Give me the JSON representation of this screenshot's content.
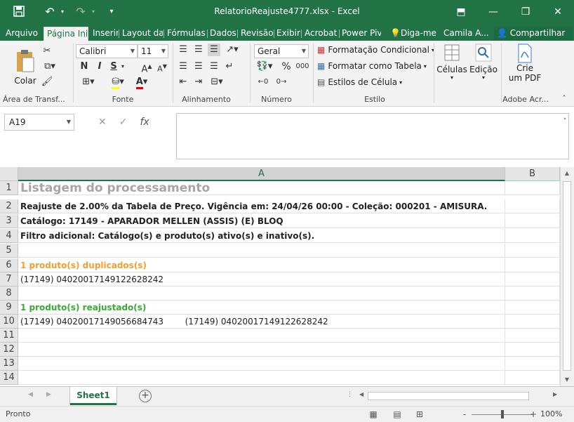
{
  "window": {
    "title": "RelatorioReajuste4777.xlsx - Excel",
    "minimize": "—",
    "restore": "❐",
    "close": "✕",
    "ribbon_display": "⬒"
  },
  "tabs": [
    {
      "label": "Arquivo"
    },
    {
      "label": "Página Inicial"
    },
    {
      "label": "Inserir"
    },
    {
      "label": "Layout da Página"
    },
    {
      "label": "Fórmulas"
    },
    {
      "label": "Dados"
    },
    {
      "label": "Revisão"
    },
    {
      "label": "Exibir"
    },
    {
      "label": "Acrobat"
    },
    {
      "label": "Power Pivot"
    },
    {
      "label": "Diga-me"
    },
    {
      "label": "Camila A..."
    },
    {
      "label": "Compartilhar"
    }
  ],
  "ribbon": {
    "paste_label": "Colar",
    "clipboard_label": "Área de Transf...",
    "font_name": "Calibri",
    "font_size": "11",
    "bold": "N",
    "italic": "I",
    "underline": "S",
    "font_label": "Fonte",
    "align_label": "Alinhamento",
    "number_format": "Geral",
    "percent": "%",
    "thousands": "000",
    "number_label": "Número",
    "cond_format": "Formatação Condicional",
    "format_table": "Formatar como Tabela",
    "cell_styles": "Estilos de Célula",
    "styles_label": "Estilo",
    "cells_label": "Células",
    "edit_label": "Edição",
    "create_pdf_line1": "Crie",
    "create_pdf_line2": "um PDF",
    "adobe_label": "Adobe Acr..."
  },
  "formula_bar": {
    "name_box": "A19",
    "cancel": "✕",
    "enter": "✓",
    "fx": "fx",
    "value": ""
  },
  "grid": {
    "columns": [
      "A",
      "B"
    ],
    "rows": [
      {
        "num": "1",
        "text": "Listagem do processamento",
        "style": "title"
      },
      {
        "num": "2",
        "text": "Reajuste de 2.00% da Tabela de Preço. Vigência em: 24/04/26 00:00 - Coleção: 000201 - AMISURA.",
        "style": "bold"
      },
      {
        "num": "3",
        "text": "Catálogo: 17149 - APARADOR MELLEN (ASSIS) (E) BLOQ",
        "style": "bold"
      },
      {
        "num": "4",
        "text": "Filtro adicional: Catálogo(s) e produto(s) ativo(s) e inativo(s).",
        "style": "bold"
      },
      {
        "num": "5",
        "text": "",
        "style": "normal"
      },
      {
        "num": "6",
        "text": "1 produto(s) duplicados(s)",
        "style": "orange"
      },
      {
        "num": "7",
        "text": "(17149) 04020017149122628242",
        "style": "normal"
      },
      {
        "num": "8",
        "text": "",
        "style": "normal"
      },
      {
        "num": "9",
        "text": "1 produto(s) reajustado(s)",
        "style": "green"
      },
      {
        "num": "10",
        "text": "(17149) 04020017149056684743        (17149) 04020017149122628242",
        "style": "normal"
      },
      {
        "num": "11",
        "text": "",
        "style": "normal"
      },
      {
        "num": "12",
        "text": "",
        "style": "normal"
      },
      {
        "num": "13",
        "text": "",
        "style": "normal"
      },
      {
        "num": "14",
        "text": "",
        "style": "normal"
      }
    ]
  },
  "colors": {
    "brand": "#217346",
    "title_gray": "#a6a6a6",
    "orange": "#f0a030",
    "green": "#3aaa35"
  },
  "sheets": [
    {
      "label": "Sheet1"
    }
  ],
  "status": {
    "ready": "Pronto",
    "zoom": "100%",
    "zoom_minus": "-",
    "zoom_plus": "+"
  }
}
